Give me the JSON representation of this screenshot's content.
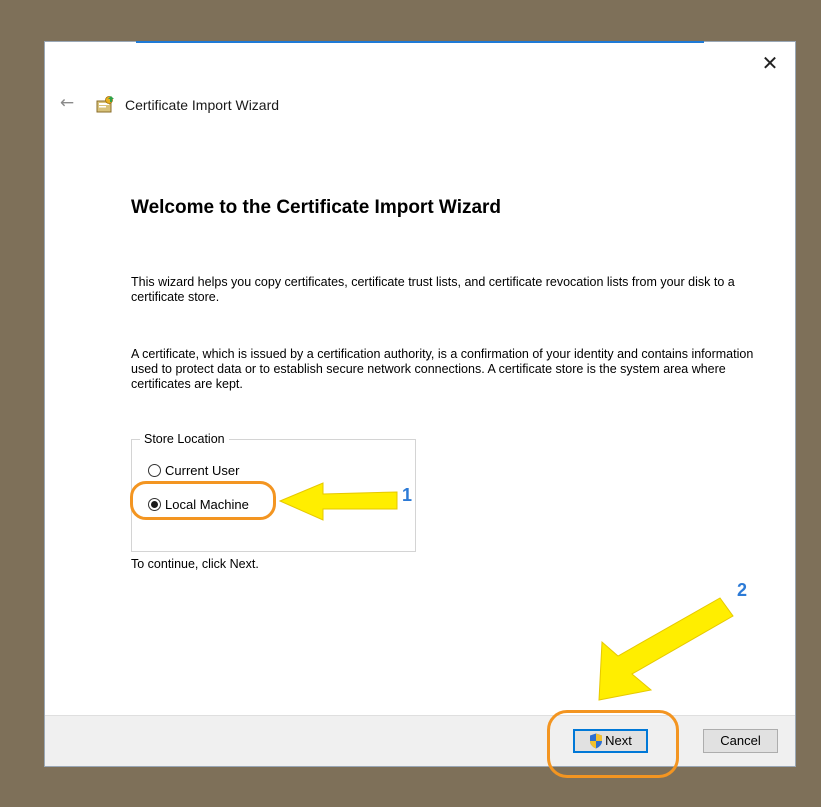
{
  "window": {
    "title": "Certificate Import Wizard",
    "close_glyph": "✕",
    "back_glyph": "←"
  },
  "content": {
    "heading": "Welcome to the Certificate Import Wizard",
    "paragraph1": "This wizard helps you copy certificates, certificate trust lists, and certificate revocation lists from your disk to a certificate store.",
    "paragraph2": "A certificate, which is issued by a certification authority, is a confirmation of your identity and contains information used to protect data or to establish secure network connections. A certificate store is the system area where certificates are kept.",
    "store_location": {
      "legend": "Store Location",
      "options": [
        {
          "label": "Current User",
          "selected": false
        },
        {
          "label": "Local Machine",
          "selected": true
        }
      ]
    },
    "continue_text": "To continue, click Next."
  },
  "footer": {
    "next_label": "Next",
    "cancel_label": "Cancel"
  },
  "annotations": {
    "callout1": "1",
    "callout2": "2",
    "highlight_color": "#f39521",
    "arrow_color": "#ffee00",
    "callout_color": "#2c7ad6"
  },
  "icons": {
    "title_icon": "certificate-icon",
    "next_icon": "uac-shield-icon"
  }
}
